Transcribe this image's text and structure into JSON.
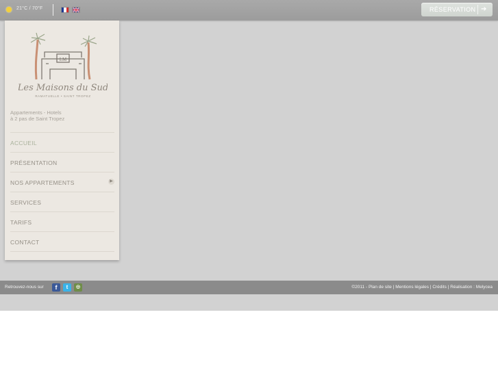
{
  "topbar": {
    "weather": "21°C / 70°F",
    "languages": [
      "FR",
      "EN"
    ],
    "reservation_label": "RÉSERVATION",
    "flag_colors": [
      "#1f3a93",
      "#ffffff",
      "#d32f2f"
    ]
  },
  "sidebar": {
    "logo": {
      "title": "Les Maisons du Sud",
      "subtitle": "RAMATUELLE • SAINT TROPEZ"
    },
    "tagline_line1": "Appartements - Hotels",
    "tagline_line2": "à 2 pas de Saint Tropez",
    "menu": [
      {
        "label": "ACCUEIL",
        "active": true
      },
      {
        "label": "PRÉSENTATION"
      },
      {
        "label": "NOS APPARTEMENTS",
        "has_submenu": true
      },
      {
        "label": "SERVICES"
      },
      {
        "label": "TARIFS"
      },
      {
        "label": "CONTACT"
      }
    ]
  },
  "footer": {
    "follow_label": "Retrouvez-nous sur",
    "social": [
      "facebook-icon",
      "twitter-icon",
      "tripadvisor-icon"
    ],
    "copyright": "©2011",
    "links": [
      "Plan de site",
      "Mentions légales",
      "Crédits",
      "Réalisation : Melycea"
    ]
  },
  "colors": {
    "page_bg": "#d2d2d2",
    "topbar": "#a3a3a3",
    "sidebar": "#ece8e2",
    "footer": "#8b8b8b",
    "accent": "#aab29c"
  }
}
